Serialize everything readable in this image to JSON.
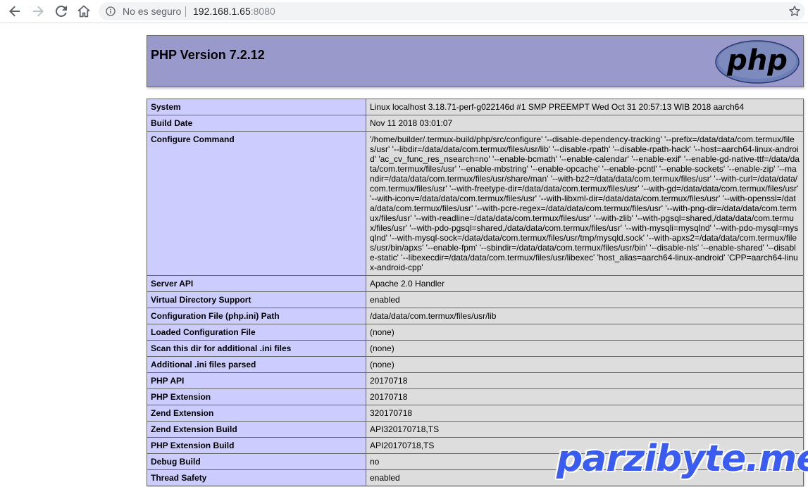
{
  "browser": {
    "security_label": "No es seguro",
    "url_host": "192.168.1.65",
    "url_port": ":8080",
    "icons": [
      "back-icon",
      "forward-icon",
      "reload-icon",
      "home-icon",
      "info-icon",
      "star-icon"
    ]
  },
  "page": {
    "title": "PHP Version 7.2.12",
    "logo_text": "php",
    "colors": {
      "header_bg": "#9999cc",
      "key_bg": "#ccccff",
      "value_bg": "#dddddd",
      "watermark": "#3a5cf0"
    },
    "rows": [
      {
        "key": "System",
        "value": "Linux localhost 3.18.71-perf-g022146d #1 SMP PREEMPT Wed Oct 31 20:57:13 WIB 2018 aarch64"
      },
      {
        "key": "Build Date",
        "value": "Nov 11 2018 03:01:07"
      },
      {
        "key": "Configure Command",
        "value": "'/home/builder/.termux-build/php/src/configure' '--disable-dependency-tracking' '--prefix=/data/data/com.termux/files/usr' '--libdir=/data/data/com.termux/files/usr/lib' '--disable-rpath' '--disable-rpath-hack' '--host=aarch64-linux-android' 'ac_cv_func_res_nsearch=no' '--enable-bcmath' '--enable-calendar' '--enable-exif' '--enable-gd-native-ttf=/data/data/com.termux/files/usr' '--enable-mbstring' '--enable-opcache' '--enable-pcntl' '--enable-sockets' '--enable-zip' '--mandir=/data/data/com.termux/files/usr/share/man' '--with-bz2=/data/data/com.termux/files/usr' '--with-curl=/data/data/com.termux/files/usr' '--with-freetype-dir=/data/data/com.termux/files/usr' '--with-gd=/data/data/com.termux/files/usr' '--with-iconv=/data/data/com.termux/files/usr' '--with-libxml-dir=/data/data/com.termux/files/usr' '--with-openssl=/data/data/com.termux/files/usr' '--with-pcre-regex=/data/data/com.termux/files/usr' '--with-png-dir=/data/data/com.termux/files/usr' '--with-readline=/data/data/com.termux/files/usr' '--with-zlib' '--with-pgsql=shared,/data/data/com.termux/files/usr' '--with-pdo-pgsql=shared,/data/data/com.termux/files/usr' '--with-mysqli=mysqlnd' '--with-pdo-mysql=mysqlnd' '--with-mysql-sock=/data/data/com.termux/files/usr/tmp/mysqld.sock' '--with-apxs2=/data/data/com.termux/files/usr/bin/apxs' '--enable-fpm' '--sbindir=/data/data/com.termux/files/usr/bin' '--disable-nls' '--enable-shared' '--disable-static' '--libexecdir=/data/data/com.termux/files/usr/libexec' 'host_alias=aarch64-linux-android' 'CPP=aarch64-linux-android-cpp'"
      },
      {
        "key": "Server API",
        "value": "Apache 2.0 Handler"
      },
      {
        "key": "Virtual Directory Support",
        "value": "enabled"
      },
      {
        "key": "Configuration File (php.ini) Path",
        "value": "/data/data/com.termux/files/usr/lib"
      },
      {
        "key": "Loaded Configuration File",
        "value": "(none)"
      },
      {
        "key": "Scan this dir for additional .ini files",
        "value": "(none)"
      },
      {
        "key": "Additional .ini files parsed",
        "value": "(none)"
      },
      {
        "key": "PHP API",
        "value": "20170718"
      },
      {
        "key": "PHP Extension",
        "value": "20170718"
      },
      {
        "key": "Zend Extension",
        "value": "320170718"
      },
      {
        "key": "Zend Extension Build",
        "value": "API320170718,TS"
      },
      {
        "key": "PHP Extension Build",
        "value": "API20170718,TS"
      },
      {
        "key": "Debug Build",
        "value": "no"
      },
      {
        "key": "Thread Safety",
        "value": "enabled"
      }
    ]
  },
  "watermark": {
    "text": "parzibyte.me"
  }
}
